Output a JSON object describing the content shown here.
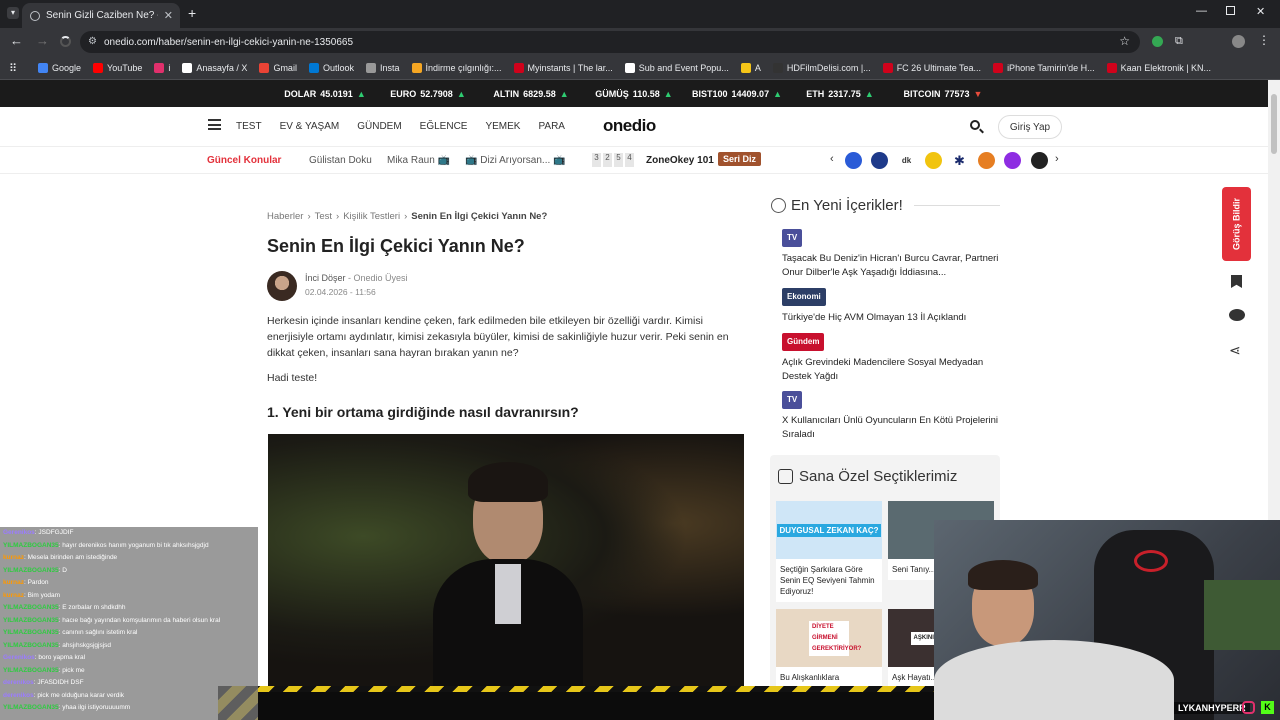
{
  "browser": {
    "tab_title": "Senin Gizli Caziben Ne? - Oned",
    "url": "onedio.com/haber/senin-en-ilgi-cekici-yanin-ne-1350665",
    "bookmarks": [
      {
        "label": "Google",
        "color": "#4285f4"
      },
      {
        "label": "YouTube",
        "color": "#ff0000"
      },
      {
        "label": "i",
        "color": "#e1306c"
      },
      {
        "label": "Anasayfa / X",
        "color": "#ffffff"
      },
      {
        "label": "Gmail",
        "color": "#ea4335"
      },
      {
        "label": "Outlook",
        "color": "#0078d4"
      },
      {
        "label": "Insta",
        "color": "#999999"
      },
      {
        "label": "İndirme çılgınlığı:...",
        "color": "#f5a623"
      },
      {
        "label": "Myinstants | The lar...",
        "color": "#d0021b"
      },
      {
        "label": "Sub and Event Popu...",
        "color": "#ffffff"
      },
      {
        "label": "A",
        "color": "#f5c518"
      },
      {
        "label": "HDFilmDelisi.com |...",
        "color": "#333333"
      },
      {
        "label": "FC 26 Ultimate Tea...",
        "color": "#d0021b"
      },
      {
        "label": "iPhone Tamirin'de H...",
        "color": "#d0021b"
      },
      {
        "label": "Kaan Elektronik | KN...",
        "color": "#d0021b"
      }
    ]
  },
  "ticker": [
    {
      "name": "DOLAR",
      "value": "45.0191",
      "dir": "up"
    },
    {
      "name": "EURO",
      "value": "52.7908",
      "dir": "up"
    },
    {
      "name": "ALTIN",
      "value": "6829.58",
      "dir": "up"
    },
    {
      "name": "GÜMÜŞ",
      "value": "110.58",
      "dir": "up"
    },
    {
      "name": "BIST100",
      "value": "14409.07",
      "dir": "up"
    },
    {
      "name": "ETH",
      "value": "2317.75",
      "dir": "up"
    },
    {
      "name": "BITCOIN",
      "value": "77573",
      "dir": "down"
    }
  ],
  "header": {
    "nav": [
      "TEST",
      "EV & YAŞAM",
      "GÜNDEM",
      "EĞLENCE",
      "YEMEK",
      "PARA"
    ],
    "logo": "onedio",
    "login": "Giriş Yap"
  },
  "topics": {
    "label": "Güncel Konular",
    "items": [
      "Gülistan Doku",
      "Mika Raun 📺",
      "📺 Dizi Arıyorsan... 📺"
    ],
    "zone_digits": [
      "3",
      "2",
      "5",
      "4"
    ],
    "zone_label": "ZoneOkey 101",
    "serie_btn": "Seri Diz"
  },
  "article": {
    "breadcrumb": [
      "Haberler",
      "Test",
      "Kişilik Testleri",
      "Senin En İlgi Çekici Yanın Ne?"
    ],
    "title": "Senin En İlgi Çekici Yanın Ne?",
    "author": "İnci Döşer",
    "author_role": "- Onedio Üyesi",
    "date": "02.04.2026 - 11:56",
    "intro": "Herkesin içinde insanları kendine çeken, fark edilmeden bile etkileyen bir özelliği vardır. Kimisi enerjisiyle ortamı aydınlatır, kimisi zekasıyla büyüler, kimisi de sakinliğiyle huzur verir. Peki senin en dikkat çeken, insanları sana hayran bırakan yanın ne?",
    "cta": "Hadi teste!",
    "question": "1. Yeni bir ortama girdiğinde nasıl davranırsın?"
  },
  "sidebar": {
    "title": "En Yeni İçerikler!",
    "items": [
      {
        "tag": "TV",
        "tag_color": "#4a4f9a",
        "text": "Taşacak Bu Deniz'in Hicran'ı Burcu Cavrar, Partneri Onur Dilber'le Aşk Yaşadığı İddiasına..."
      },
      {
        "tag": "Ekonomi",
        "tag_color": "#2c3e66",
        "text": "Türkiye'de Hiç AVM Olmayan 13 İl Açıklandı"
      },
      {
        "tag": "Gündem",
        "tag_color": "#c8102e",
        "text": "Açlık Grevindeki Madencilere Sosyal Medyadan Destek Yağdı"
      },
      {
        "tag": "TV",
        "tag_color": "#4a4f9a",
        "text": "X Kullanıcıları Ünlü Oyuncuların En Kötü Projelerini Sıraladı"
      }
    ],
    "picks_title": "Sana Özel Seçtiklerimiz",
    "picks": [
      {
        "text": "Seçtiğin Şarkılara Göre Senin EQ Seviyeni Tahmin Ediyoruz!",
        "img_text": "DUYGUSAL ZEKAN KAÇ?"
      },
      {
        "text": "Seni Tanıy... Aklında İlk...",
        "img_text": ""
      },
      {
        "text": "Bu Alışkanlıklara",
        "img_text": "DİYETE GİRMENİ GEREKTİRİYOR?"
      },
      {
        "text": "Aşk Hayatı...",
        "img_text": "AŞKINI HE... YÖN..."
      }
    ],
    "feedback": "Görüş Bildir"
  },
  "chat": [
    {
      "user": "Gerenikos",
      "color": "#9b7bff",
      "msg": ": JSDFGJDIF"
    },
    {
      "user": "YILMAZBOGAN35",
      "color": "#2ecc40",
      "msg": ": hayır derenikos hanım yoganum bi tık ahksıhsjgdjd"
    },
    {
      "user": "kurnaz",
      "color": "#ff9900",
      "msg": ": Mesela birinden am istediğinde"
    },
    {
      "user": "YILMAZBOGAN35",
      "color": "#2ecc40",
      "msg": ": D"
    },
    {
      "user": "kurnaz",
      "color": "#ff9900",
      "msg": ": Pardon"
    },
    {
      "user": "kurnaz",
      "color": "#ff9900",
      "msg": ": Bim yodam"
    },
    {
      "user": "YILMAZBOGAN35",
      "color": "#2ecc40",
      "msg": ": E zorbalar m shdkdhh"
    },
    {
      "user": "YILMAZBOGAN35",
      "color": "#2ecc40",
      "msg": ": hacıe bağı yayından komşularımın da haberi olsun kral"
    },
    {
      "user": "YILMAZBOGAN35",
      "color": "#2ecc40",
      "msg": ": canının sağlını istetim kral"
    },
    {
      "user": "YILMAZBOGAN35",
      "color": "#2ecc40",
      "msg": ": ahsjıhskgsjgjsjsd"
    },
    {
      "user": "Gerenikos",
      "color": "#9b7bff",
      "msg": ": boro yapma kral"
    },
    {
      "user": "YILMAZBOGAN35",
      "color": "#2ecc40",
      "msg": ": pick me"
    },
    {
      "user": "derenikos",
      "color": "#9b7bff",
      "msg": ": JFASDIDH DSF"
    },
    {
      "user": "derenikos",
      "color": "#9b7bff",
      "msg": ": pick me olduğuna karar verdik"
    },
    {
      "user": "YILMAZBOGAN35",
      "color": "#2ecc40",
      "msg": ": yhaa ilgi istiyoruuuumm"
    }
  ],
  "webcam": {
    "name": "LYKANHYPERR"
  }
}
